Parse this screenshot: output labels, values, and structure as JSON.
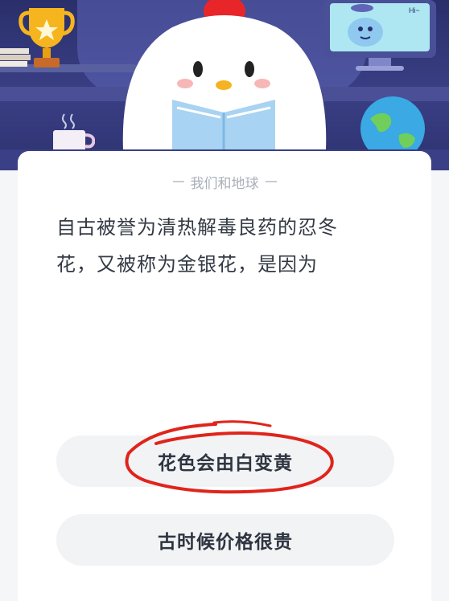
{
  "header": {
    "monitor_text": "Hi~",
    "icons": [
      "trophy-icon",
      "books-icon",
      "mug-icon",
      "monitor-icon",
      "globe-icon",
      "mascot-penguin-icon"
    ]
  },
  "quiz": {
    "topic": "我们和地球",
    "question_line1": "自古被誉为清热解毒良药的忍冬",
    "question_line2": "花，又被称为金银花，是因为",
    "options": [
      {
        "label": "花色会由白变黄",
        "highlighted": true
      },
      {
        "label": "古时候价格很贵",
        "highlighted": false
      }
    ]
  },
  "colors": {
    "header_bg": "#2a2f6b",
    "annotation": "#e0241b",
    "option_bg": "#f1f3f5",
    "text": "#333a44"
  }
}
